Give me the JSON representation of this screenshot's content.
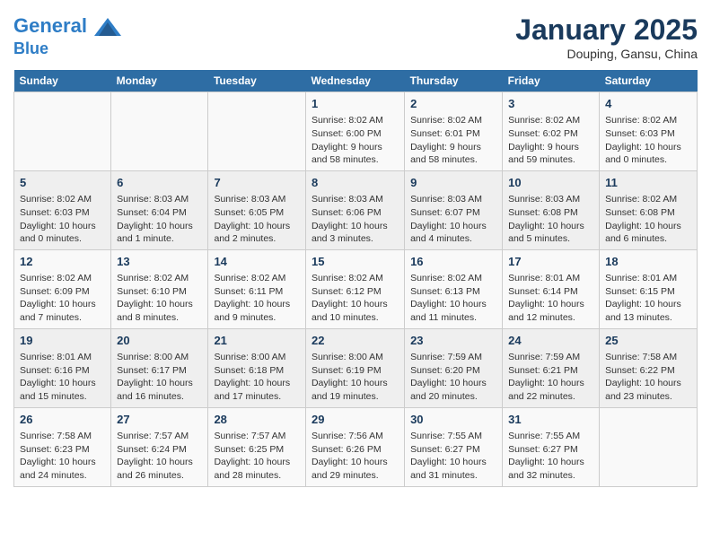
{
  "header": {
    "logo_line1": "General",
    "logo_line2": "Blue",
    "month": "January 2025",
    "location": "Douping, Gansu, China"
  },
  "weekdays": [
    "Sunday",
    "Monday",
    "Tuesday",
    "Wednesday",
    "Thursday",
    "Friday",
    "Saturday"
  ],
  "weeks": [
    [
      {
        "day": "",
        "info": ""
      },
      {
        "day": "",
        "info": ""
      },
      {
        "day": "",
        "info": ""
      },
      {
        "day": "1",
        "info": "Sunrise: 8:02 AM\nSunset: 6:00 PM\nDaylight: 9 hours and 58 minutes."
      },
      {
        "day": "2",
        "info": "Sunrise: 8:02 AM\nSunset: 6:01 PM\nDaylight: 9 hours and 58 minutes."
      },
      {
        "day": "3",
        "info": "Sunrise: 8:02 AM\nSunset: 6:02 PM\nDaylight: 9 hours and 59 minutes."
      },
      {
        "day": "4",
        "info": "Sunrise: 8:02 AM\nSunset: 6:03 PM\nDaylight: 10 hours and 0 minutes."
      }
    ],
    [
      {
        "day": "5",
        "info": "Sunrise: 8:02 AM\nSunset: 6:03 PM\nDaylight: 10 hours and 0 minutes."
      },
      {
        "day": "6",
        "info": "Sunrise: 8:03 AM\nSunset: 6:04 PM\nDaylight: 10 hours and 1 minute."
      },
      {
        "day": "7",
        "info": "Sunrise: 8:03 AM\nSunset: 6:05 PM\nDaylight: 10 hours and 2 minutes."
      },
      {
        "day": "8",
        "info": "Sunrise: 8:03 AM\nSunset: 6:06 PM\nDaylight: 10 hours and 3 minutes."
      },
      {
        "day": "9",
        "info": "Sunrise: 8:03 AM\nSunset: 6:07 PM\nDaylight: 10 hours and 4 minutes."
      },
      {
        "day": "10",
        "info": "Sunrise: 8:03 AM\nSunset: 6:08 PM\nDaylight: 10 hours and 5 minutes."
      },
      {
        "day": "11",
        "info": "Sunrise: 8:02 AM\nSunset: 6:08 PM\nDaylight: 10 hours and 6 minutes."
      }
    ],
    [
      {
        "day": "12",
        "info": "Sunrise: 8:02 AM\nSunset: 6:09 PM\nDaylight: 10 hours and 7 minutes."
      },
      {
        "day": "13",
        "info": "Sunrise: 8:02 AM\nSunset: 6:10 PM\nDaylight: 10 hours and 8 minutes."
      },
      {
        "day": "14",
        "info": "Sunrise: 8:02 AM\nSunset: 6:11 PM\nDaylight: 10 hours and 9 minutes."
      },
      {
        "day": "15",
        "info": "Sunrise: 8:02 AM\nSunset: 6:12 PM\nDaylight: 10 hours and 10 minutes."
      },
      {
        "day": "16",
        "info": "Sunrise: 8:02 AM\nSunset: 6:13 PM\nDaylight: 10 hours and 11 minutes."
      },
      {
        "day": "17",
        "info": "Sunrise: 8:01 AM\nSunset: 6:14 PM\nDaylight: 10 hours and 12 minutes."
      },
      {
        "day": "18",
        "info": "Sunrise: 8:01 AM\nSunset: 6:15 PM\nDaylight: 10 hours and 13 minutes."
      }
    ],
    [
      {
        "day": "19",
        "info": "Sunrise: 8:01 AM\nSunset: 6:16 PM\nDaylight: 10 hours and 15 minutes."
      },
      {
        "day": "20",
        "info": "Sunrise: 8:00 AM\nSunset: 6:17 PM\nDaylight: 10 hours and 16 minutes."
      },
      {
        "day": "21",
        "info": "Sunrise: 8:00 AM\nSunset: 6:18 PM\nDaylight: 10 hours and 17 minutes."
      },
      {
        "day": "22",
        "info": "Sunrise: 8:00 AM\nSunset: 6:19 PM\nDaylight: 10 hours and 19 minutes."
      },
      {
        "day": "23",
        "info": "Sunrise: 7:59 AM\nSunset: 6:20 PM\nDaylight: 10 hours and 20 minutes."
      },
      {
        "day": "24",
        "info": "Sunrise: 7:59 AM\nSunset: 6:21 PM\nDaylight: 10 hours and 22 minutes."
      },
      {
        "day": "25",
        "info": "Sunrise: 7:58 AM\nSunset: 6:22 PM\nDaylight: 10 hours and 23 minutes."
      }
    ],
    [
      {
        "day": "26",
        "info": "Sunrise: 7:58 AM\nSunset: 6:23 PM\nDaylight: 10 hours and 24 minutes."
      },
      {
        "day": "27",
        "info": "Sunrise: 7:57 AM\nSunset: 6:24 PM\nDaylight: 10 hours and 26 minutes."
      },
      {
        "day": "28",
        "info": "Sunrise: 7:57 AM\nSunset: 6:25 PM\nDaylight: 10 hours and 28 minutes."
      },
      {
        "day": "29",
        "info": "Sunrise: 7:56 AM\nSunset: 6:26 PM\nDaylight: 10 hours and 29 minutes."
      },
      {
        "day": "30",
        "info": "Sunrise: 7:55 AM\nSunset: 6:27 PM\nDaylight: 10 hours and 31 minutes."
      },
      {
        "day": "31",
        "info": "Sunrise: 7:55 AM\nSunset: 6:27 PM\nDaylight: 10 hours and 32 minutes."
      },
      {
        "day": "",
        "info": ""
      }
    ]
  ]
}
